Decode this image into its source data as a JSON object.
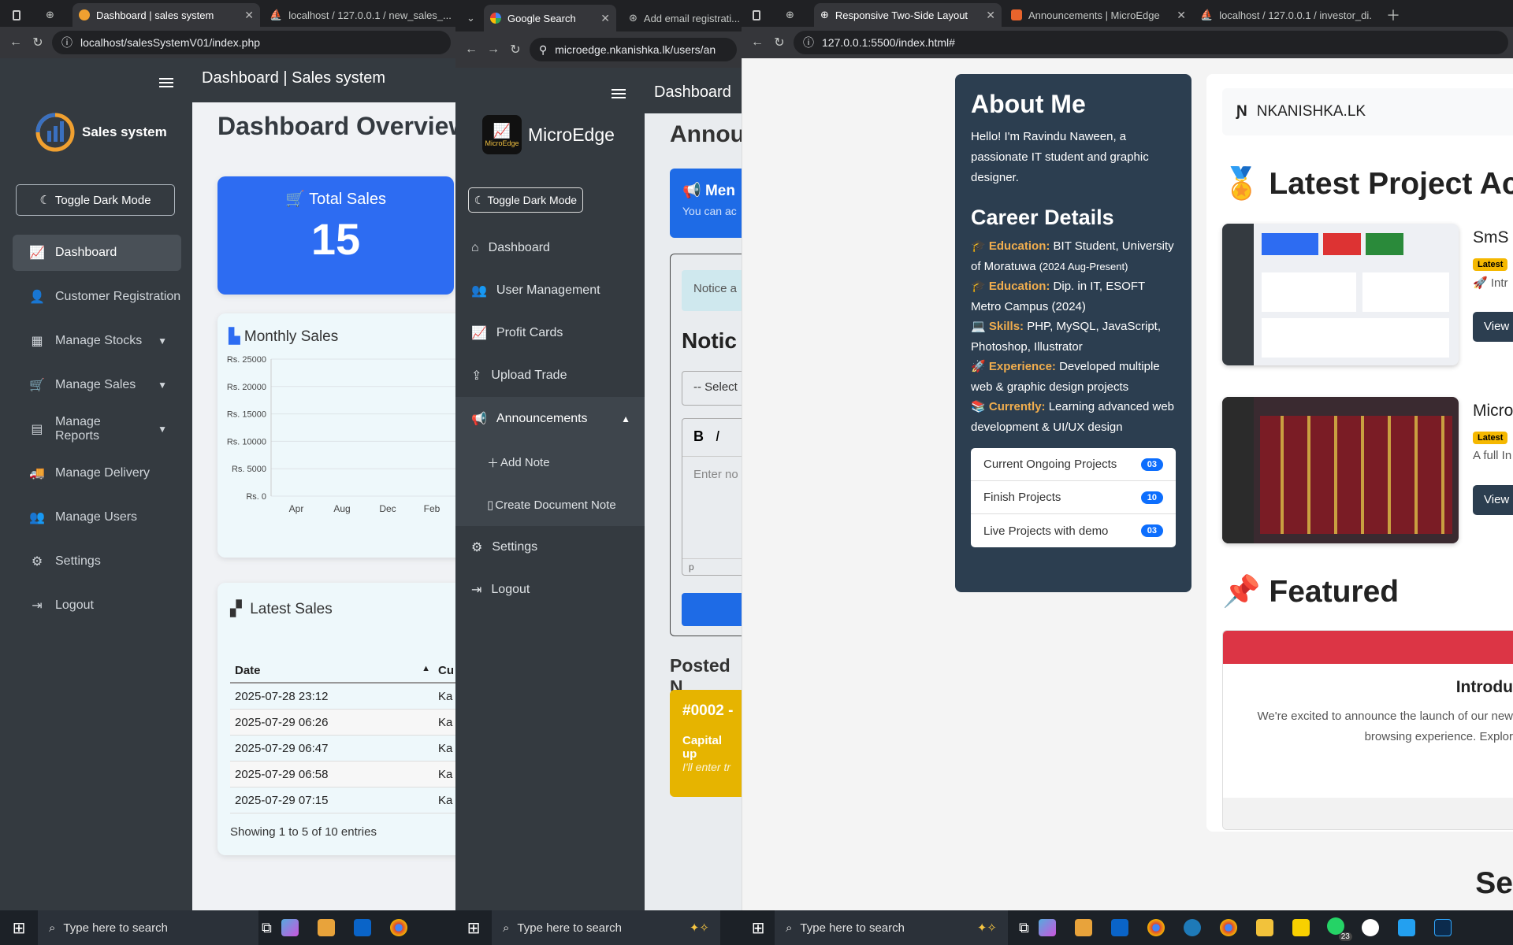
{
  "w1": {
    "tabs": [
      "Dashboard | sales system",
      "localhost / 127.0.0.1 / new_sales_..."
    ],
    "url": "localhost/salesSystemV01/index.php",
    "header_title": "Dashboard | Sales system",
    "brand": "Sales system",
    "toggle_label": "Toggle Dark Mode",
    "nav": [
      {
        "label": "Dashboard"
      },
      {
        "label": "Customer Registration"
      },
      {
        "label": "Manage Stocks"
      },
      {
        "label": "Manage Sales"
      },
      {
        "label": "Manage Reports"
      },
      {
        "label": "Manage Delivery"
      },
      {
        "label": "Manage Users"
      },
      {
        "label": "Settings"
      },
      {
        "label": "Logout"
      }
    ],
    "page_title": "Dashboard Overview",
    "total_sales_label": "Total Sales",
    "total_sales_value": "15",
    "monthly_sales_title": "Monthly Sales",
    "chart_data": {
      "type": "bar",
      "title": "Monthly Sales",
      "y_ticks": [
        "Rs. 25000",
        "Rs. 20000",
        "Rs. 15000",
        "Rs. 10000",
        "Rs. 5000",
        "Rs. 0"
      ],
      "x_ticks": [
        "Apr",
        "Aug",
        "Dec",
        "Feb"
      ],
      "ylim": [
        0,
        25000
      ]
    },
    "latest_sales_title": "Latest Sales",
    "table_header": "Date",
    "table_header2": "Cu",
    "rows": [
      "2025-07-28 23:12",
      "2025-07-29 06:26",
      "2025-07-29 06:47",
      "2025-07-29 06:58",
      "2025-07-29 07:15"
    ],
    "row_cut": "Ka",
    "entries": "Showing 1 to 5 of 10 entries"
  },
  "w2": {
    "tabs": [
      "Google Search",
      "Add email registrati..."
    ],
    "url": "microedge.nkanishka.lk/users/an",
    "header_title": "Dashboard",
    "brand": "MicroEdge",
    "logo_text": "MicroEdge",
    "toggle_label": "Toggle Dark Mode",
    "nav": [
      "Dashboard",
      "User Management",
      "Profit Cards",
      "Upload Trade",
      "Announcements"
    ],
    "sub": [
      "Add Note",
      "Create Document Note"
    ],
    "nav2": [
      "Settings",
      "Logout"
    ],
    "page_title": "Annou",
    "banner_title": "Men",
    "banner_text": "You can ac",
    "notice_alert": "Notice a",
    "notice_title": "Notic",
    "select_text": "-- Select",
    "editor_b": "B",
    "editor_i": "I",
    "editor_placeholder": "Enter no",
    "editor_status": "p",
    "posted_title": "Posted N",
    "post_id": "#0002 -",
    "post_title": "Capital up",
    "post_text": "I'll enter tr"
  },
  "w3": {
    "tabs": [
      "Responsive Two-Side Layout",
      "Announcements | MicroEdge",
      "localhost / 127.0.0.1 / investor_di..."
    ],
    "url": "127.0.0.1:5500/index.html#",
    "about_title": "About Me",
    "about_text": "Hello! I'm Ravindu Naween, a passionate IT student and graphic designer.",
    "career_title": "Career Details",
    "career": [
      {
        "icon": "🎓",
        "label": "Education:",
        "text": "BIT Student, University of Moratuwa",
        "small": "(2024 Aug-Present)"
      },
      {
        "icon": "🎓",
        "label": "Education:",
        "text": "Dip. in IT, ESOFT Metro Campus (2024)",
        "small": ""
      },
      {
        "icon": "💻",
        "label": "Skills:",
        "text": "PHP, MySQL, JavaScript, Photoshop, Illustrator",
        "small": ""
      },
      {
        "icon": "🚀",
        "label": "Experience:",
        "text": "Developed multiple web & graphic design projects",
        "small": ""
      },
      {
        "icon": "📚",
        "label": "Currently:",
        "text": "Learning advanced web development & UI/UX design",
        "small": ""
      }
    ],
    "stats": [
      {
        "label": "Current Ongoing Projects",
        "count": "03"
      },
      {
        "label": "Finish Projects",
        "count": "10"
      },
      {
        "label": "Live Projects with demo",
        "count": "03"
      }
    ],
    "site_name": "NKANISHKA.LK",
    "latest_title": "Latest Project Ach",
    "proj1_title": "SmS",
    "proj2_title": "Micro",
    "badge": "Latest",
    "proj1_desc": "Intr",
    "proj2_desc": "A full In",
    "view": "View",
    "featured_title": "Featured",
    "intro_title": "Introdu",
    "intro_text1": "We're excited to announce the launch of our new",
    "intro_text2": "browsing experience. Explor",
    "next_section": "Se"
  },
  "taskbar": {
    "search": "Type here to search",
    "badge_count": "23"
  }
}
